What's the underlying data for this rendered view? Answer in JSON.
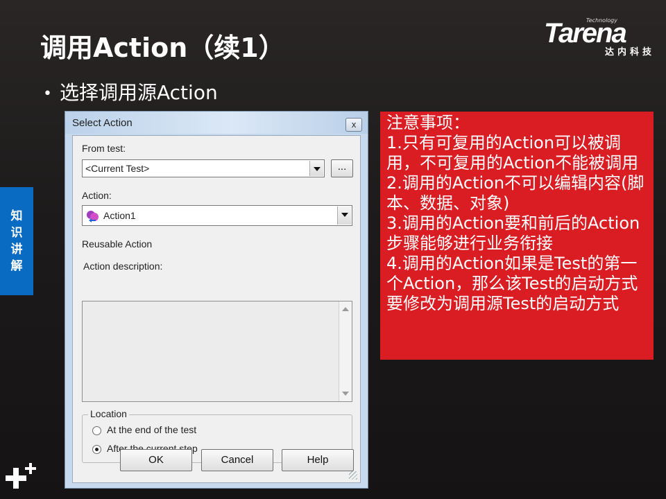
{
  "slide": {
    "title": "调用Action（续1）",
    "bullet": "选择调用源Action",
    "side_tab": [
      "知",
      "识",
      "讲",
      "解"
    ],
    "logo": {
      "tech": "Technology",
      "main": "Tarena",
      "sub": "达内科技"
    }
  },
  "dialog": {
    "title": "Select Action",
    "close_label": "x",
    "from_test_label": "From test:",
    "from_test_value": "<Current Test>",
    "browse_label": "...",
    "action_label": "Action:",
    "action_value": "Action1",
    "reusable_text": "Reusable Action",
    "description_label": "Action description:",
    "location_label": "Location",
    "location_options": [
      {
        "label": "At the end of the test",
        "selected": false
      },
      {
        "label": "After the current step",
        "selected": true
      }
    ],
    "ok_label": "OK",
    "cancel_label": "Cancel",
    "help_label": "Help"
  },
  "note": {
    "lines": [
      "注意事项：",
      "1.只有可复用的Action可以被调用，不可复用的Action不能被调用",
      "2.调用的Action不可以编辑内容(脚本、数据、对象)",
      "3.调用的Action要和前后的Action步骤能够进行业务衔接",
      "4.调用的Action如果是Test的第一个Action，那么该Test的启动方式要修改为调用源Test的启动方式"
    ]
  }
}
